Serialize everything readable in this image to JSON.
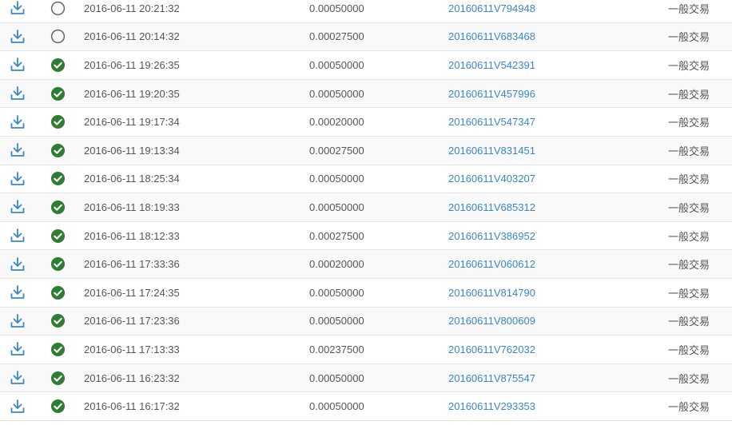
{
  "colors": {
    "link": "#3a87c8",
    "download_icon": "#3a87c8",
    "confirmed": "#2e7d32",
    "pending_ring": "#666666",
    "row_border": "#e4e4e4",
    "row_alt": "#f9f9f9"
  },
  "icons": {
    "download": "download-icon",
    "confirmed": "check-circle-icon",
    "pending": "empty-circle-icon"
  },
  "transactions": [
    {
      "status": "pending",
      "time": "2016-06-11 20:21:32",
      "amount": "0.00050000",
      "txid": "20160611V794948",
      "type": "一般交易"
    },
    {
      "status": "pending",
      "time": "2016-06-11 20:14:32",
      "amount": "0.00027500",
      "txid": "20160611V683468",
      "type": "一般交易"
    },
    {
      "status": "confirmed",
      "time": "2016-06-11 19:26:35",
      "amount": "0.00050000",
      "txid": "20160611V542391",
      "type": "一般交易"
    },
    {
      "status": "confirmed",
      "time": "2016-06-11 19:20:35",
      "amount": "0.00050000",
      "txid": "20160611V457996",
      "type": "一般交易"
    },
    {
      "status": "confirmed",
      "time": "2016-06-11 19:17:34",
      "amount": "0.00020000",
      "txid": "20160611V547347",
      "type": "一般交易"
    },
    {
      "status": "confirmed",
      "time": "2016-06-11 19:13:34",
      "amount": "0.00027500",
      "txid": "20160611V831451",
      "type": "一般交易"
    },
    {
      "status": "confirmed",
      "time": "2016-06-11 18:25:34",
      "amount": "0.00050000",
      "txid": "20160611V403207",
      "type": "一般交易"
    },
    {
      "status": "confirmed",
      "time": "2016-06-11 18:19:33",
      "amount": "0.00050000",
      "txid": "20160611V685312",
      "type": "一般交易"
    },
    {
      "status": "confirmed",
      "time": "2016-06-11 18:12:33",
      "amount": "0.00027500",
      "txid": "20160611V386952",
      "type": "一般交易"
    },
    {
      "status": "confirmed",
      "time": "2016-06-11 17:33:36",
      "amount": "0.00020000",
      "txid": "20160611V060612",
      "type": "一般交易"
    },
    {
      "status": "confirmed",
      "time": "2016-06-11 17:24:35",
      "amount": "0.00050000",
      "txid": "20160611V814790",
      "type": "一般交易"
    },
    {
      "status": "confirmed",
      "time": "2016-06-11 17:23:36",
      "amount": "0.00050000",
      "txid": "20160611V800609",
      "type": "一般交易"
    },
    {
      "status": "confirmed",
      "time": "2016-06-11 17:13:33",
      "amount": "0.00237500",
      "txid": "20160611V762032",
      "type": "一般交易"
    },
    {
      "status": "confirmed",
      "time": "2016-06-11 16:23:32",
      "amount": "0.00050000",
      "txid": "20160611V875547",
      "type": "一般交易"
    },
    {
      "status": "confirmed",
      "time": "2016-06-11 16:17:32",
      "amount": "0.00050000",
      "txid": "20160611V293353",
      "type": "一般交易"
    }
  ]
}
